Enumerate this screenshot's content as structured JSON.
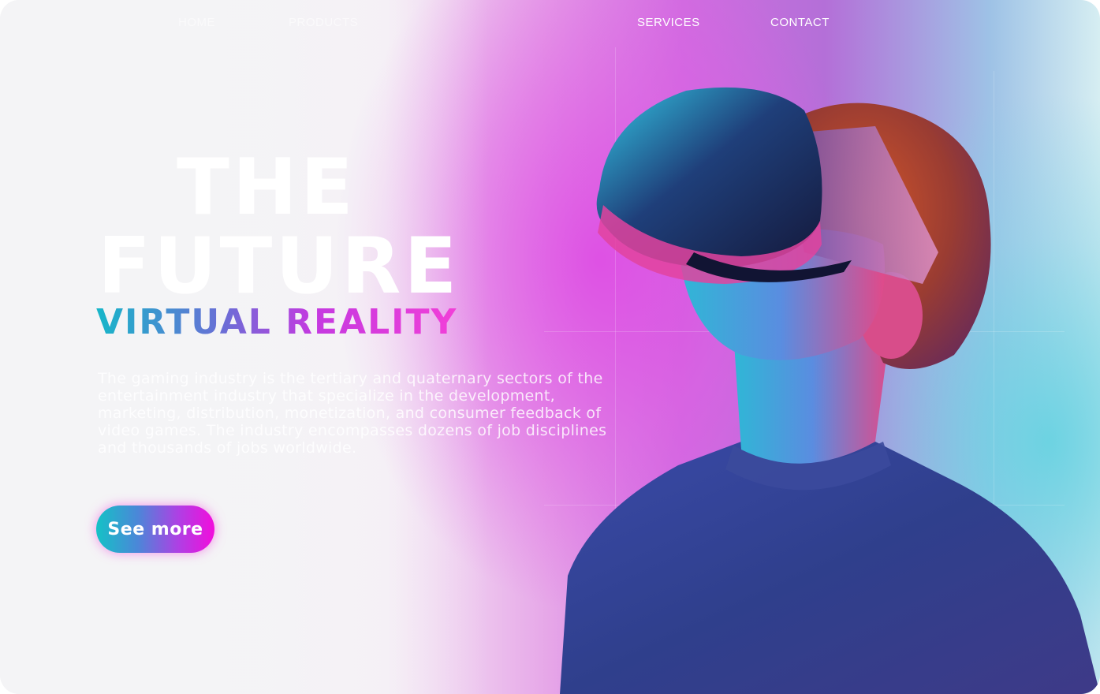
{
  "nav": {
    "items": [
      {
        "label": "HOME"
      },
      {
        "label": "PRODUCTS"
      },
      {
        "label": "SERVICES"
      },
      {
        "label": "CONTACT"
      }
    ]
  },
  "hero": {
    "headline_line1": "THE",
    "headline_line2": "FUTURE",
    "subheadline": "VIRTUAL REALITY",
    "description": "The gaming industry is the tertiary and quaternary sectors of the entertainment industry that specialize in the development, marketing, distribution, monetization, and consumer feedback of video games. The industry encompasses dozens of job disciplines and thousands of jobs worldwide.",
    "cta_label": "See more",
    "image_alt": "boy-wearing-vr-headset"
  },
  "colors": {
    "accent_cyan": "#14c2c6",
    "accent_magenta": "#f20ddc",
    "accent_purple": "#b03fe4"
  }
}
